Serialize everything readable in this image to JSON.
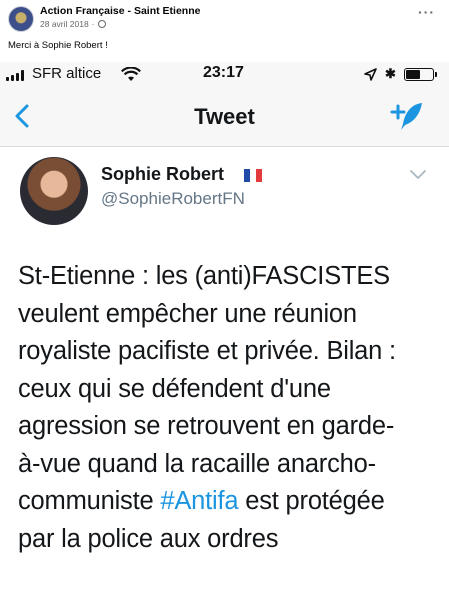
{
  "post": {
    "page_name": "Action Française - Saint Etienne",
    "date": "28 avril 2018",
    "separator": "·",
    "caption": "Merci à Sophie Robert !",
    "more_label": "···"
  },
  "status_bar": {
    "carrier": "SFR altice",
    "time": "23:17",
    "battery_level": 0.55
  },
  "nav": {
    "title": "Tweet"
  },
  "tweet": {
    "author_name": "Sophie Robert",
    "author_handle": "@SophieRobertFN",
    "flag_colors": [
      "#1f4aa8",
      "#ffffff",
      "#e33b3b"
    ],
    "lines": [
      {
        "text": "St-Etienne : les (anti)FASCISTES"
      },
      {
        "text": "veulent empêcher une réunion"
      },
      {
        "text": "royaliste pacifiste et privée. Bilan :"
      },
      {
        "text": "ceux qui se défendent d'une"
      },
      {
        "text": "agression se retrouvent en garde-"
      },
      {
        "text": "à-vue quand la racaille anarcho-"
      },
      {
        "text_before": "communiste ",
        "hashtag": "#Antifa",
        "text_after": " est protégée"
      },
      {
        "text": "par la police aux ordres"
      }
    ]
  },
  "colors": {
    "link_blue": "#1b95e0",
    "text_dark": "#14171a",
    "handle_gray": "#657786"
  }
}
